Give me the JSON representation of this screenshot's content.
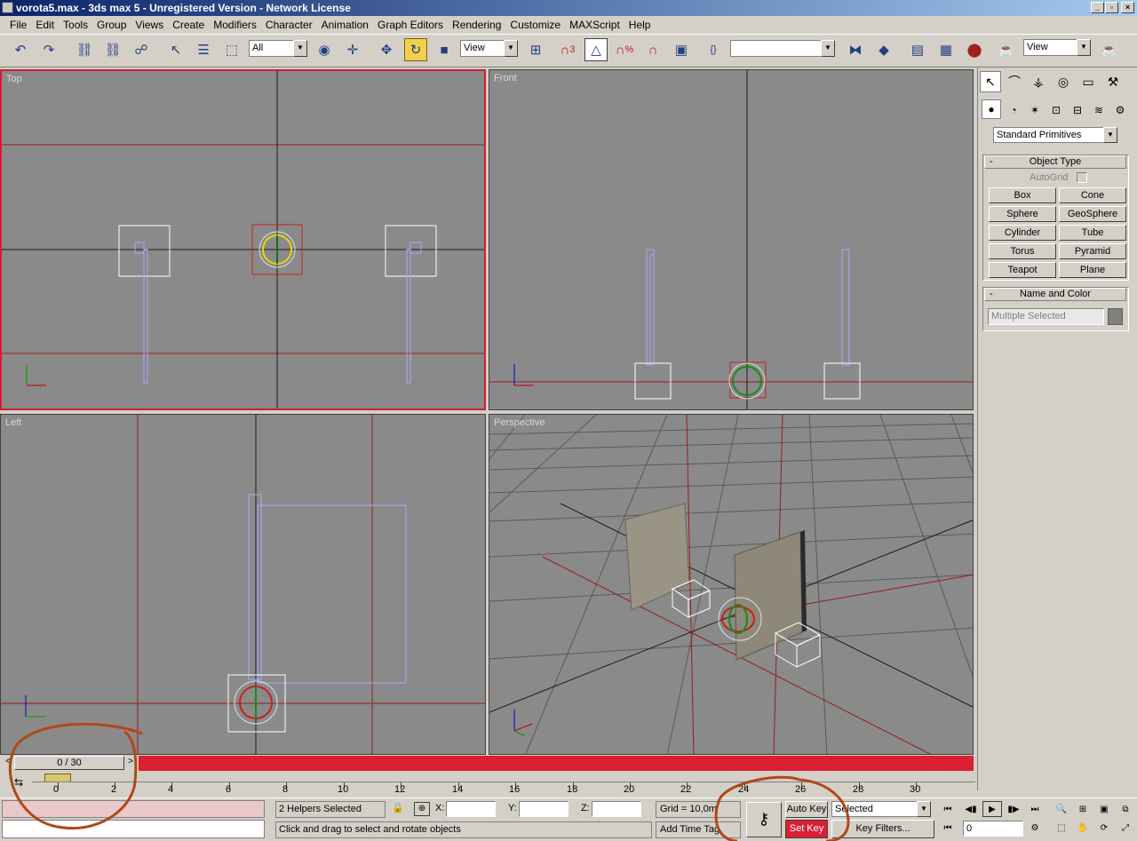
{
  "window": {
    "title": "vorota5.max - 3ds max 5 - Unregistered Version - Network License",
    "min_glyph": "_",
    "max_glyph": "▫",
    "close_glyph": "×"
  },
  "menu": [
    "File",
    "Edit",
    "Tools",
    "Group",
    "Views",
    "Create",
    "Modifiers",
    "Character",
    "Animation",
    "Graph Editors",
    "Rendering",
    "Customize",
    "MAXScript",
    "Help"
  ],
  "toolbar": {
    "selection_filter": "All",
    "ref_coord": "View",
    "named_selection": "",
    "view2": "View",
    "snap_label": "3",
    "percent_label": "%"
  },
  "viewports": {
    "top": "Top",
    "front": "Front",
    "left": "Left",
    "perspective": "Perspective"
  },
  "command_panel": {
    "category": "Standard Primitives",
    "object_type_title": "Object Type",
    "autogrid": "AutoGrid",
    "buttons": [
      "Box",
      "Cone",
      "Sphere",
      "GeoSphere",
      "Cylinder",
      "Tube",
      "Torus",
      "Pyramid",
      "Teapot",
      "Plane"
    ],
    "name_color_title": "Name and Color",
    "name_value": "Multiple Selected",
    "minus": "-",
    "accent_color": "#808080"
  },
  "timeline": {
    "slider_label": "0 / 30",
    "ticks": [
      "0",
      "2",
      "4",
      "6",
      "8",
      "10",
      "12",
      "14",
      "16",
      "18",
      "20",
      "22",
      "24",
      "26",
      "28",
      "30"
    ],
    "track_color": "#dc1e32"
  },
  "status": {
    "selection": "2 Helpers Selected",
    "prompt": "Click and drag to select and rotate objects",
    "x_label": "X:",
    "y_label": "Y:",
    "z_label": "Z:",
    "grid": "Grid = 10,0m",
    "add_time_tag": "Add Time Tag",
    "auto_key": "Auto Key",
    "set_key": "Set Key",
    "key_mode": "Selected",
    "key_filters": "Key Filters...",
    "frame": "0"
  }
}
